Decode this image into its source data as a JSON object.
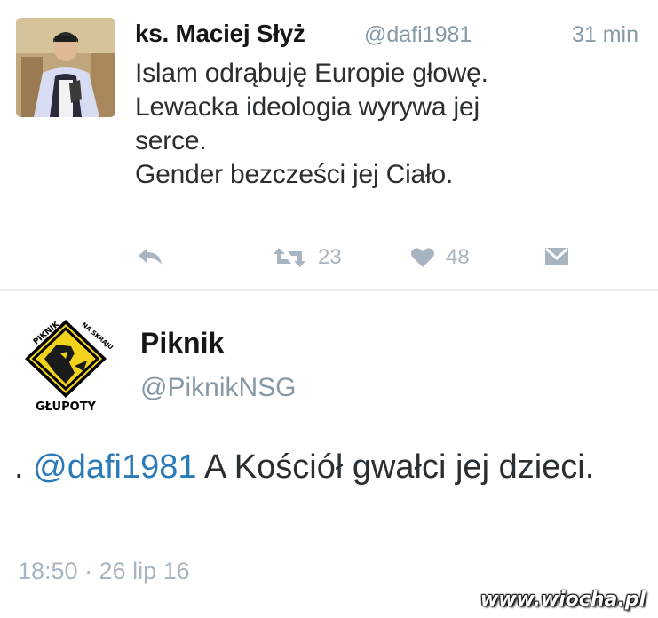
{
  "tweets": [
    {
      "author_name": "ks. Maciej Słyż",
      "handle": "@dafi1981",
      "time": "31 min",
      "lines": [
        "Islam odrąbuję Europie głowę.",
        "Lewacka ideologia wyrywa jej",
        "serce.",
        "Gender bezcześci jej Ciało."
      ],
      "retweets": "23",
      "likes": "48",
      "icons": [
        "reply-icon",
        "retweet-icon",
        "like-icon",
        "message-icon"
      ]
    },
    {
      "author_name": "Piknik",
      "handle": "@PiknikNSG",
      "text_prefix": ". ",
      "mention": "@dafi1981",
      "text_rest": " A Kościół gwałci jej dzieci.",
      "meta": "18:50 · 26 lip 16",
      "avatar_logo": {
        "top_text": "PIKNIK",
        "side_text": "NA SKRAJU",
        "bottom_text": "GŁUPOTY"
      }
    }
  ],
  "watermark": "www.wiocha.pl",
  "colors": {
    "name": "#14171a",
    "text": "#292f33",
    "muted": "#8899a6",
    "action": "#a8b5c0",
    "mention": "#2b7bb9",
    "divider": "#e6ecf0",
    "logo_yellow": "#f2d21b"
  }
}
